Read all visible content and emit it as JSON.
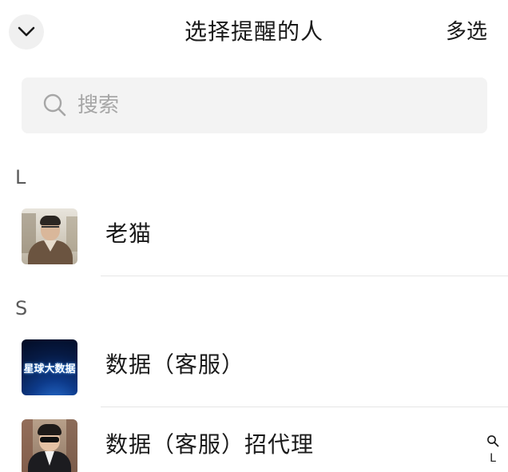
{
  "header": {
    "collapse_icon": "chevron-down-icon",
    "title": "选择提醒的人",
    "multi_select_label": "多选"
  },
  "search": {
    "icon": "search-icon",
    "placeholder": "搜索",
    "value": ""
  },
  "sections": [
    {
      "letter": "L",
      "contacts": [
        {
          "name": "老猫",
          "avatar": "photo-man-glasses"
        }
      ]
    },
    {
      "letter": "S",
      "contacts": [
        {
          "name": "数据（客服）",
          "avatar": "logo",
          "avatar_text": "星球大数据"
        },
        {
          "name": "数据（客服）招代理",
          "avatar": "photo-boy-sunglasses"
        }
      ]
    }
  ],
  "index_bar": {
    "search_icon": "search-icon",
    "letters": [
      "L"
    ]
  },
  "colors": {
    "background": "#ffffff",
    "search_bg": "#f3f3f3",
    "placeholder": "#a6a6a6",
    "divider": "#e6e6e6",
    "text": "#1a1a1a"
  }
}
